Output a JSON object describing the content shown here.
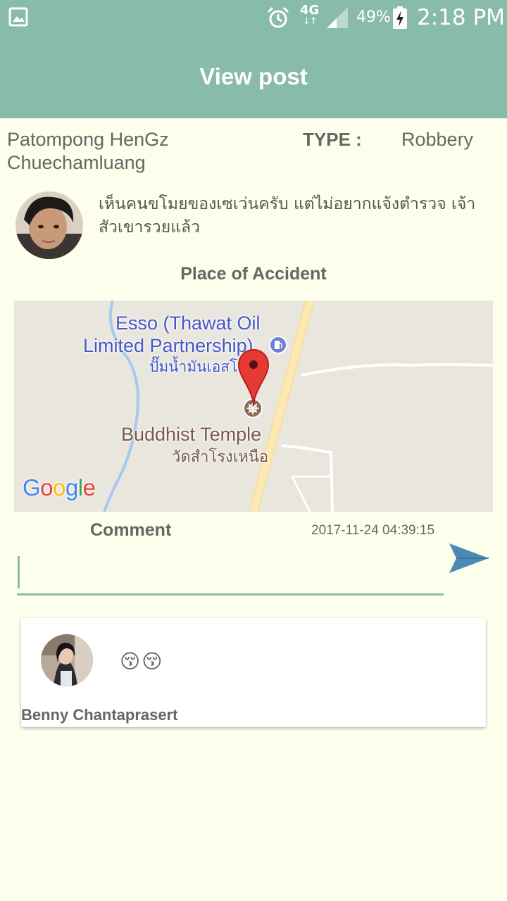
{
  "status_bar": {
    "network": "4G",
    "battery": "49%",
    "time": "2:18 PM"
  },
  "header": {
    "title": "View post"
  },
  "post": {
    "author": "Patompong HenGz Chuechamluang",
    "type_label": "TYPE :",
    "type_value": "Robbery",
    "description": "เห็นคนขโมยของเซเว่นครับ แต่ไม่อยากแจ้งตำรวจ เจ้าสัวเขารวยแล้ว",
    "place_label": "Place of Accident",
    "comment_label": "Comment",
    "timestamp": "2017-11-24 04:39:15"
  },
  "map": {
    "poi_name_line1": "Esso (Thawat Oil",
    "poi_name_line2": "Limited Partnership)",
    "poi_name_thai": "ปั๊มน้ำมันเอสโซ่",
    "temple_name": "Buddhist Temple",
    "temple_name_thai": "วัดสำโรงเหนือ",
    "logo": "Google",
    "logo_colors": [
      "#4285F4",
      "#EA4335",
      "#FBBC05",
      "#4285F4",
      "#34A853",
      "#EA4335"
    ]
  },
  "comment_input": {
    "value": "",
    "placeholder": ""
  },
  "comments": [
    {
      "text": "😚😚",
      "author": "Benny Chantaprasert"
    }
  ],
  "colors": {
    "primary": "#88BBA8",
    "background": "#FEFEEC",
    "send_icon": "#4A8BB5"
  }
}
